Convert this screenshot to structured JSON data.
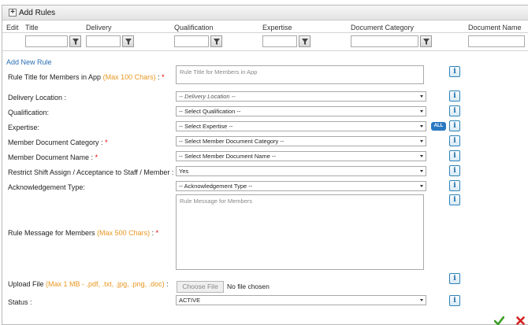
{
  "panel": {
    "title": "Add Rules"
  },
  "grid": {
    "columns": [
      "Edit",
      "Title",
      "Delivery",
      "Qualification",
      "Expertise",
      "Document Category",
      "Document Name"
    ]
  },
  "form": {
    "add_new_label": "Add New Rule",
    "rule_title": {
      "label": "Rule Title for Members in App",
      "hint": "(Max 100 Chars)",
      "suffix": " : ",
      "required": "*",
      "placeholder": "Rule Title for Members in App"
    },
    "delivery_location": {
      "label": "Delivery Location :",
      "value": "-- Delivery Location --"
    },
    "qualification": {
      "label": "Qualification:",
      "value": "-- Select Qualification --"
    },
    "expertise": {
      "label": "Expertise:",
      "value": "-- Select Expertise --",
      "all_label": "ALL"
    },
    "doc_category": {
      "label": "Member Document Category :",
      "required": "*",
      "value": "-- Select Member Document Category --"
    },
    "doc_name": {
      "label": "Member Document Name :",
      "required": "*",
      "value": "-- Select Member Document Name --"
    },
    "restrict_shift": {
      "label": "Restrict Shift Assign / Acceptance to Staff / Member :",
      "value": "Yes"
    },
    "ack_type": {
      "label": "Acknowledgement Type:",
      "value": "-- Acknowledgement Type --"
    },
    "rule_message": {
      "label": "Rule Message for Members",
      "hint": "(Max 500 Chars)",
      "suffix": " : ",
      "required": "*",
      "placeholder": "Rule Message for Members"
    },
    "upload": {
      "label": "Upload File",
      "hint": "(Max 1 MB - .pdf, .txt, .jpg, .png, .doc)",
      "suffix": " :",
      "button_label": "Choose File",
      "status": "No file chosen"
    },
    "status": {
      "label": "Status :",
      "value": "ACTIVE"
    },
    "info_label": "i"
  },
  "colors": {
    "accent": "#2a78c2",
    "hint": "#e8961f",
    "required": "#e00000",
    "ok": "#3a9d23",
    "cancel": "#d42020"
  },
  "icons": [
    "plus-icon",
    "filter-icon",
    "info-icon",
    "chevron-down-icon",
    "checkmark-icon",
    "close-icon"
  ]
}
